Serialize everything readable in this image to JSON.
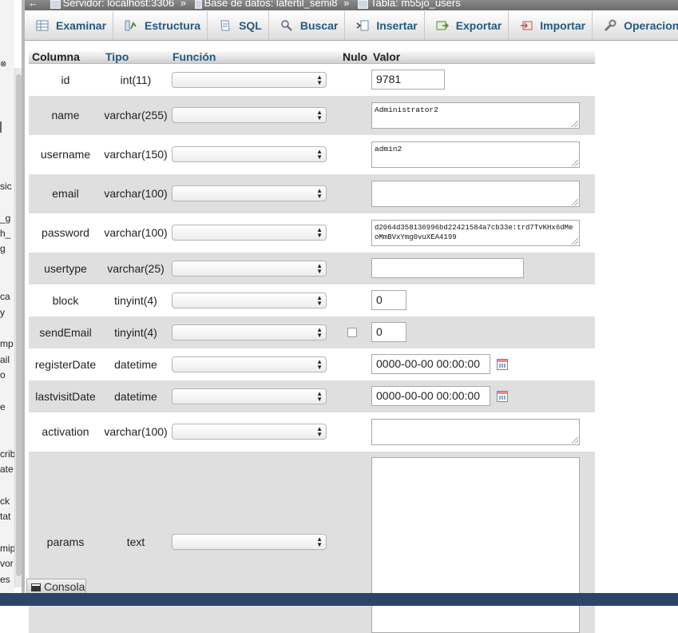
{
  "breadcrumb": {
    "server": "Servidor: localhost:3306",
    "database": "Base de datos: lafertil_semi8",
    "table": "Tabla: m55jo_users",
    "separator": "»"
  },
  "tabs": [
    {
      "label": "Examinar",
      "icon": "browse-icon"
    },
    {
      "label": "Estructura",
      "icon": "structure-icon"
    },
    {
      "label": "SQL",
      "icon": "sql-icon"
    },
    {
      "label": "Buscar",
      "icon": "search-icon"
    },
    {
      "label": "Insertar",
      "icon": "insert-icon"
    },
    {
      "label": "Exportar",
      "icon": "export-icon"
    },
    {
      "label": "Importar",
      "icon": "import-icon"
    },
    {
      "label": "Operaciones",
      "icon": "wrench-icon"
    }
  ],
  "headers": {
    "column": "Columna",
    "type": "Tipo",
    "function": "Función",
    "null": "Nulo",
    "value": "Valor"
  },
  "rows": [
    {
      "name": "id",
      "type": "int(11)",
      "value": "9781"
    },
    {
      "name": "name",
      "type": "varchar(255)",
      "value": "Administrator2"
    },
    {
      "name": "username",
      "type": "varchar(150)",
      "value": "admin2"
    },
    {
      "name": "email",
      "type": "varchar(100)",
      "value": ""
    },
    {
      "name": "password",
      "type": "varchar(100)",
      "value": "d2064d358136996bd22421584a7cb33e:trd7TvKHx6dMeoMmBVxYmg0vuXEA4199"
    },
    {
      "name": "usertype",
      "type": "varchar(25)",
      "value": ""
    },
    {
      "name": "block",
      "type": "tinyint(4)",
      "value": "0"
    },
    {
      "name": "sendEmail",
      "type": "tinyint(4)",
      "value": "0",
      "nullable": true
    },
    {
      "name": "registerDate",
      "type": "datetime",
      "value": "0000-00-00 00:00:00"
    },
    {
      "name": "lastvisitDate",
      "type": "datetime",
      "value": "0000-00-00 00:00:00"
    },
    {
      "name": "activation",
      "type": "varchar(100)",
      "value": ""
    },
    {
      "name": "params",
      "type": "text",
      "value": ""
    }
  ],
  "left_fragments": [
    "sic",
    "_g",
    "h_",
    "g",
    "ca",
    "y",
    "mp",
    "ail",
    "o",
    "e",
    "crib",
    "ate",
    "ck",
    "tat",
    "mip",
    "vor",
    "es"
  ],
  "console": {
    "label": "Consola"
  }
}
